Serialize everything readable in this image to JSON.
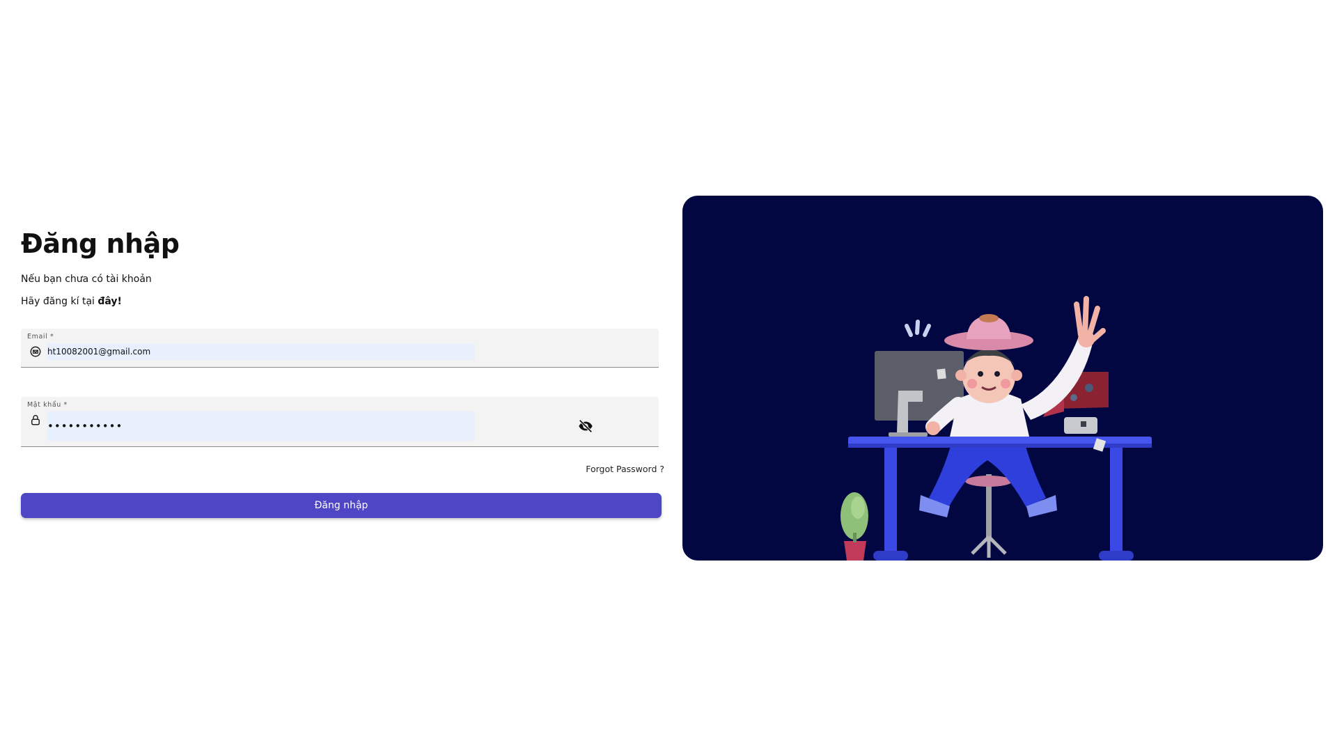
{
  "page": {
    "title": "Đăng nhập",
    "subtitle_line1": "Nếu bạn chưa có tài khoản",
    "subtitle_line2_prefix": "Hãy đăng kí tại ",
    "subtitle_line2_link": "đây!"
  },
  "form": {
    "email": {
      "label": "Email *",
      "value": "ht10082001@gmail.com",
      "icon": "mail-icon"
    },
    "password": {
      "label": "Mật khẩu *",
      "value": "•••••••••••",
      "icon": "lock-icon",
      "toggle_icon": "eye-off-icon"
    },
    "forgot_label": "Forgot Password ?",
    "submit_label": "Đăng nhập"
  },
  "colors": {
    "primary": "#4f46c6",
    "panel_background": "#020742",
    "field_background": "#f3f3f3",
    "autofill_background": "#e8f0fe"
  },
  "illustration": {
    "subject": "3d-character-at-desk-illustration"
  }
}
